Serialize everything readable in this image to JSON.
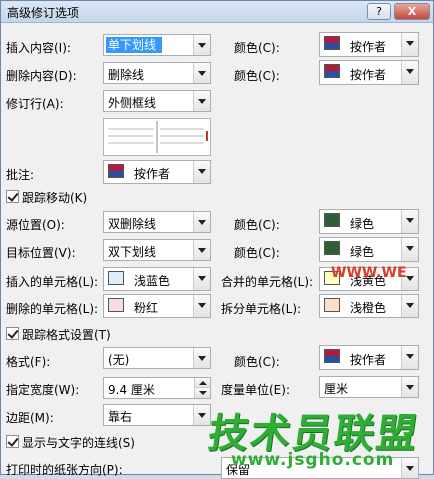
{
  "title": "高级修订选项",
  "titlebar": {
    "help": "?",
    "close": "X"
  },
  "insert": {
    "label": "插入内容(I):",
    "value": "单下划线",
    "color_label": "颜色(C):",
    "color_value": "按作者"
  },
  "delete": {
    "label": "删除内容(D):",
    "value": "删除线",
    "color_label": "颜色(C):",
    "color_value": "按作者"
  },
  "changed_line": {
    "label": "修订行(A):",
    "value": "外侧框线"
  },
  "comment": {
    "label": "批注:",
    "value": "按作者"
  },
  "track_moves": {
    "label": "跟踪移动(K)",
    "checked": true
  },
  "move_from": {
    "label": "源位置(O):",
    "value": "双删除线",
    "color_label": "颜色(C):",
    "color_value": "绿色",
    "swatch": "#2e5e35"
  },
  "move_to": {
    "label": "目标位置(V):",
    "value": "双下划线",
    "color_label": "颜色(C):",
    "color_value": "绿色",
    "swatch": "#2e5e35"
  },
  "inserted_cells": {
    "label": "插入的单元格(L):",
    "value": "浅蓝色",
    "swatch": "#dbeefa"
  },
  "merged_cells": {
    "label": "合并的单元格(L):",
    "value": "浅黄色",
    "swatch": "#ffffc0"
  },
  "deleted_cells": {
    "label": "删除的单元格(L):",
    "value": "粉红",
    "swatch": "#f7dbe6"
  },
  "split_cells": {
    "label": "拆分单元格(L):",
    "value": "浅橙色",
    "swatch": "#fde0c6"
  },
  "track_formatting": {
    "label": "跟踪格式设置(T)",
    "checked": true
  },
  "formatting": {
    "label": "格式(F):",
    "value": "(无)",
    "color_label": "颜色(C):",
    "color_value": "按作者"
  },
  "width": {
    "label": "指定宽度(W):",
    "value": "9.4 厘米",
    "unit_label": "度量单位(E):",
    "unit_value": "厘米"
  },
  "margin": {
    "label": "边距(M):",
    "value": "靠右"
  },
  "show_lines": {
    "label": "显示与文字的连线(S)",
    "checked": true
  },
  "print_orientation": {
    "label": "打印时的纸张方向(P):",
    "value": "保留"
  },
  "watermark": {
    "brand": "技术员联盟",
    "url": "www.jsgho.com",
    "partial": "WWW.WE"
  },
  "colors": {
    "author_top": "#b31b3a",
    "author_bottom": "#2a4fa6",
    "highlight": "#3399ff"
  }
}
